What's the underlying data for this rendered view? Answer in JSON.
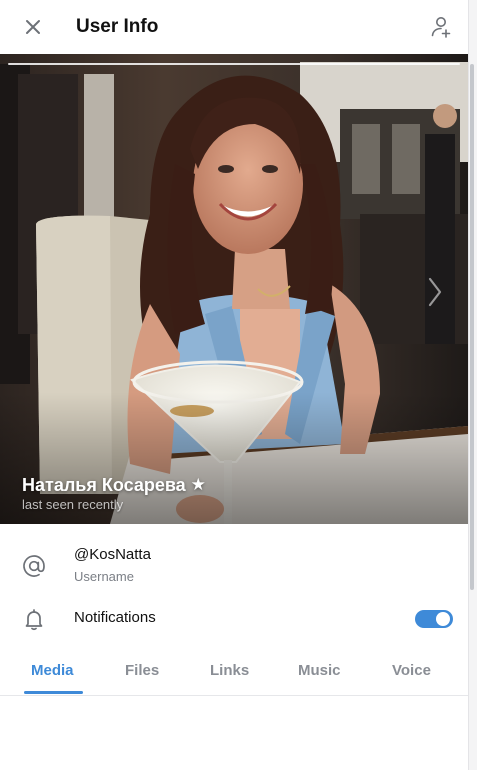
{
  "header": {
    "title": "User Info",
    "close_icon": "close-icon",
    "add_contact_icon": "add-contact-icon"
  },
  "profile": {
    "name": "Наталья Косарева",
    "status": "last seen recently",
    "star_icon": "star-icon",
    "next_icon": "chevron-right-icon"
  },
  "info": {
    "username_value": "@KosNatta",
    "username_label": "Username",
    "notifications_label": "Notifications",
    "notifications_enabled": true
  },
  "tabs": [
    {
      "label": "Media",
      "active": true
    },
    {
      "label": "Files",
      "active": false
    },
    {
      "label": "Links",
      "active": false
    },
    {
      "label": "Music",
      "active": false
    },
    {
      "label": "Voice",
      "active": false
    }
  ],
  "colors": {
    "accent": "#3e8ad8",
    "text": "#111111",
    "muted": "#7b7f86"
  }
}
